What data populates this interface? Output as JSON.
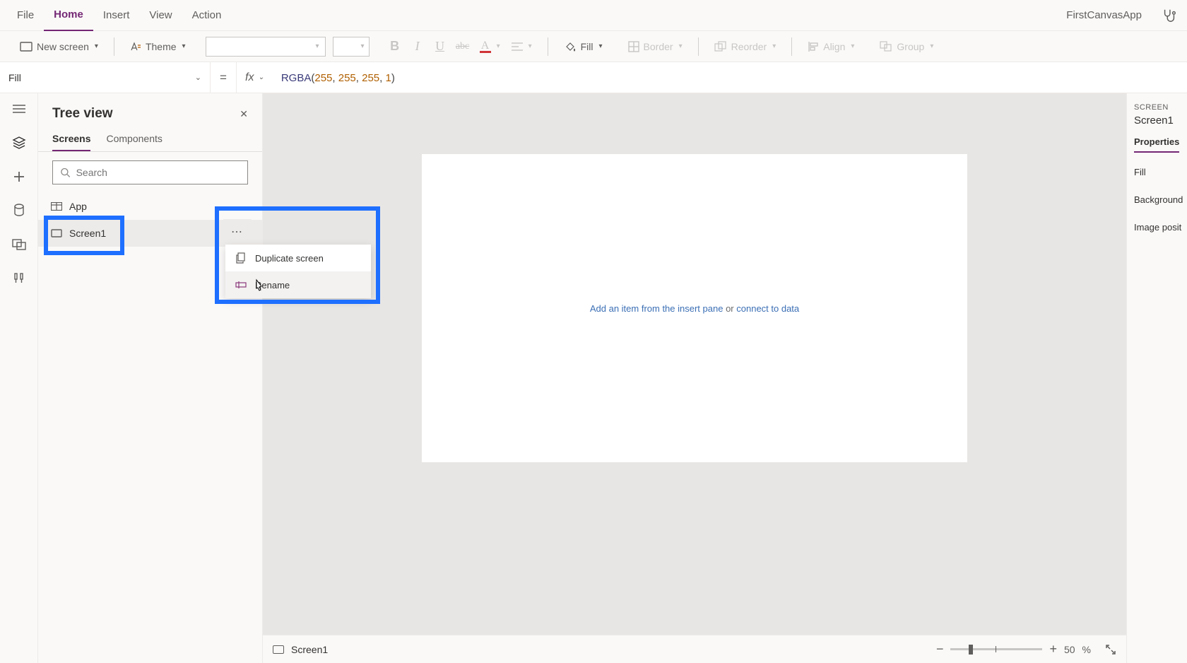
{
  "menubar": {
    "items": [
      "File",
      "Home",
      "Insert",
      "View",
      "Action"
    ],
    "active_index": 1,
    "app_name": "FirstCanvasApp"
  },
  "ribbon": {
    "new_screen": "New screen",
    "theme": "Theme",
    "fill": "Fill",
    "border": "Border",
    "reorder": "Reorder",
    "align": "Align",
    "group": "Group"
  },
  "formula_bar": {
    "property": "Fill",
    "fx": "fx",
    "formula_parts": {
      "fn": "RGBA",
      "args": [
        "255",
        "255",
        "255",
        "1"
      ]
    }
  },
  "tree_panel": {
    "title": "Tree view",
    "tabs": [
      "Screens",
      "Components"
    ],
    "active_tab": 0,
    "search_placeholder": "Search",
    "items": [
      {
        "label": "App",
        "kind": "app"
      },
      {
        "label": "Screen1",
        "kind": "screen",
        "selected": true
      }
    ]
  },
  "canvas": {
    "hint_link1": "Add an item from the insert pane",
    "hint_static": " or ",
    "hint_link2": "connect to data"
  },
  "context_menu": {
    "items": [
      {
        "label": "Duplicate screen",
        "icon": "copy"
      },
      {
        "label": "Rename",
        "icon": "rename",
        "hover": true
      }
    ]
  },
  "status_bar": {
    "screen": "Screen1",
    "zoom": "50",
    "zoom_unit": "%"
  },
  "props_panel": {
    "heading": "SCREEN",
    "name": "Screen1",
    "tab": "Properties",
    "rows": [
      "Fill",
      "Background",
      "Image posit"
    ]
  }
}
